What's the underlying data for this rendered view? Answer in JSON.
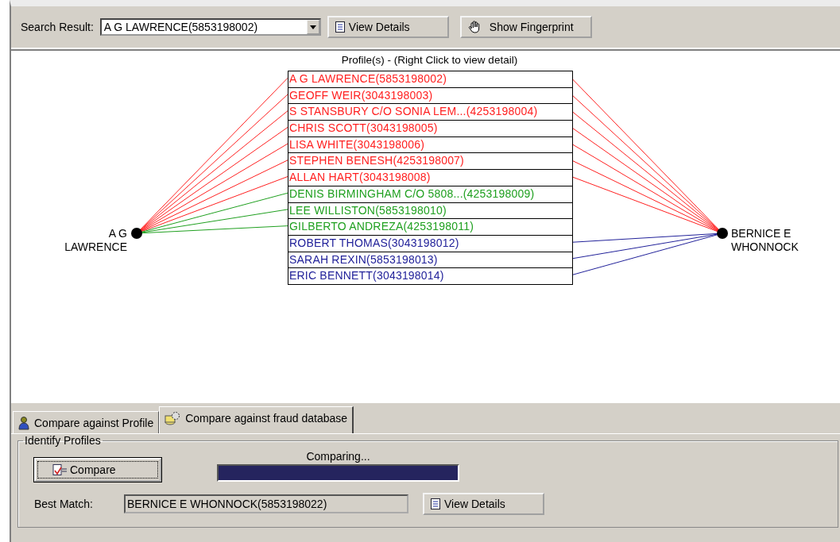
{
  "search": {
    "label": "Search Result:",
    "value": "A G LAWRENCE(5853198002)",
    "view_button": "View Details",
    "fingerprint_button": "Show Fingerprint"
  },
  "diagram": {
    "title": "Profile(s) - (Right Click to view detail)",
    "left_node": "A G LAWRENCE",
    "right_node": "BERNICE E WHONNOCK",
    "profiles": [
      {
        "label": "A G LAWRENCE(5853198002)",
        "color": "#ff2020",
        "kind": "both"
      },
      {
        "label": "GEOFF WEIR(3043198003)",
        "color": "#ff2020",
        "kind": "both"
      },
      {
        "label": "S STANSBURY C/O SONIA LEM...(4253198004)",
        "color": "#ff2020",
        "kind": "both"
      },
      {
        "label": "CHRIS SCOTT(3043198005)",
        "color": "#ff2020",
        "kind": "both"
      },
      {
        "label": "LISA WHITE(3043198006)",
        "color": "#ff2020",
        "kind": "both"
      },
      {
        "label": "STEPHEN BENESH(4253198007)",
        "color": "#ff2020",
        "kind": "both"
      },
      {
        "label": "ALLAN HART(3043198008)",
        "color": "#ff2020",
        "kind": "both"
      },
      {
        "label": "DENIS BIRMINGHAM C/O 5808...(4253198009)",
        "color": "#20a020",
        "kind": "left"
      },
      {
        "label": "LEE WILLISTON(5853198010)",
        "color": "#20a020",
        "kind": "left"
      },
      {
        "label": "GILBERTO ANDREZA(4253198011)",
        "color": "#20a020",
        "kind": "left"
      },
      {
        "label": "ROBERT THOMAS(3043198012)",
        "color": "#22229a",
        "kind": "right"
      },
      {
        "label": "SARAH REXIN(5853198013)",
        "color": "#22229a",
        "kind": "right"
      },
      {
        "label": "ERIC BENNETT(3043198014)",
        "color": "#22229a",
        "kind": "right"
      }
    ]
  },
  "tabs": [
    {
      "label": "Compare against Profile",
      "selected": false
    },
    {
      "label": "Compare against fraud database",
      "selected": true
    }
  ],
  "identify": {
    "title": "Identify Profiles",
    "compare_button": "Compare",
    "status": "Comparing...",
    "level": 1,
    "best_match_label": "Best Match:",
    "best_match": "BERNICE E WHONNOCK(5853198022)",
    "view_button": "View Details"
  }
}
